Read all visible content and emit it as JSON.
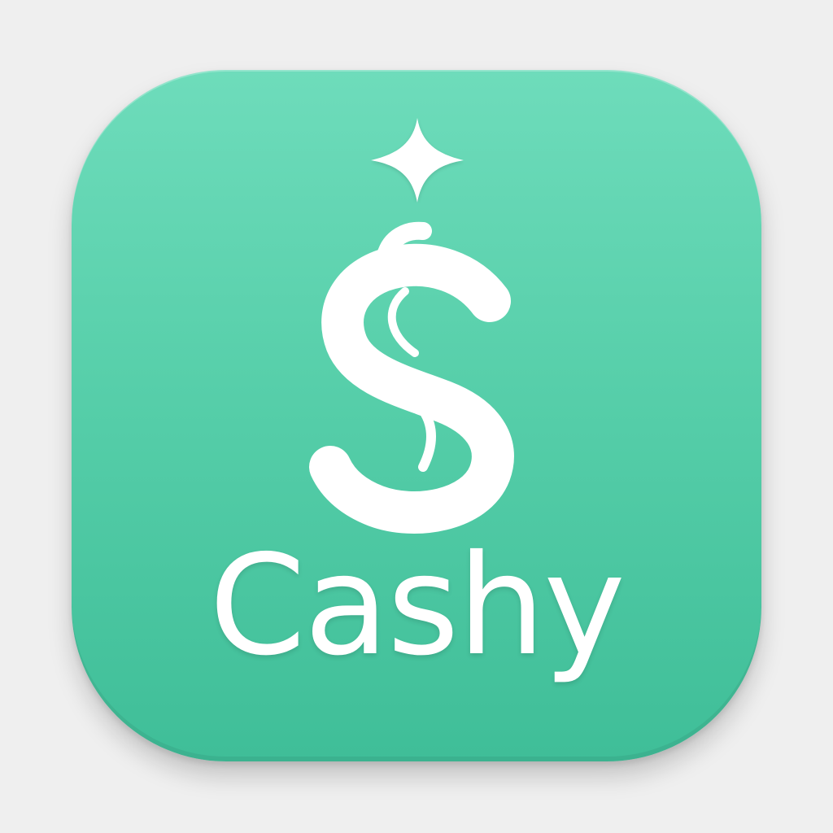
{
  "app": {
    "name": "Cashy"
  },
  "icons": {
    "sparkle": "sparkle-icon",
    "logo": "dollar-sign-icon"
  },
  "colors": {
    "background": "#efefef",
    "tile_top": "#6edcbb",
    "tile_bottom": "#3fbe98",
    "foreground": "#ffffff"
  }
}
